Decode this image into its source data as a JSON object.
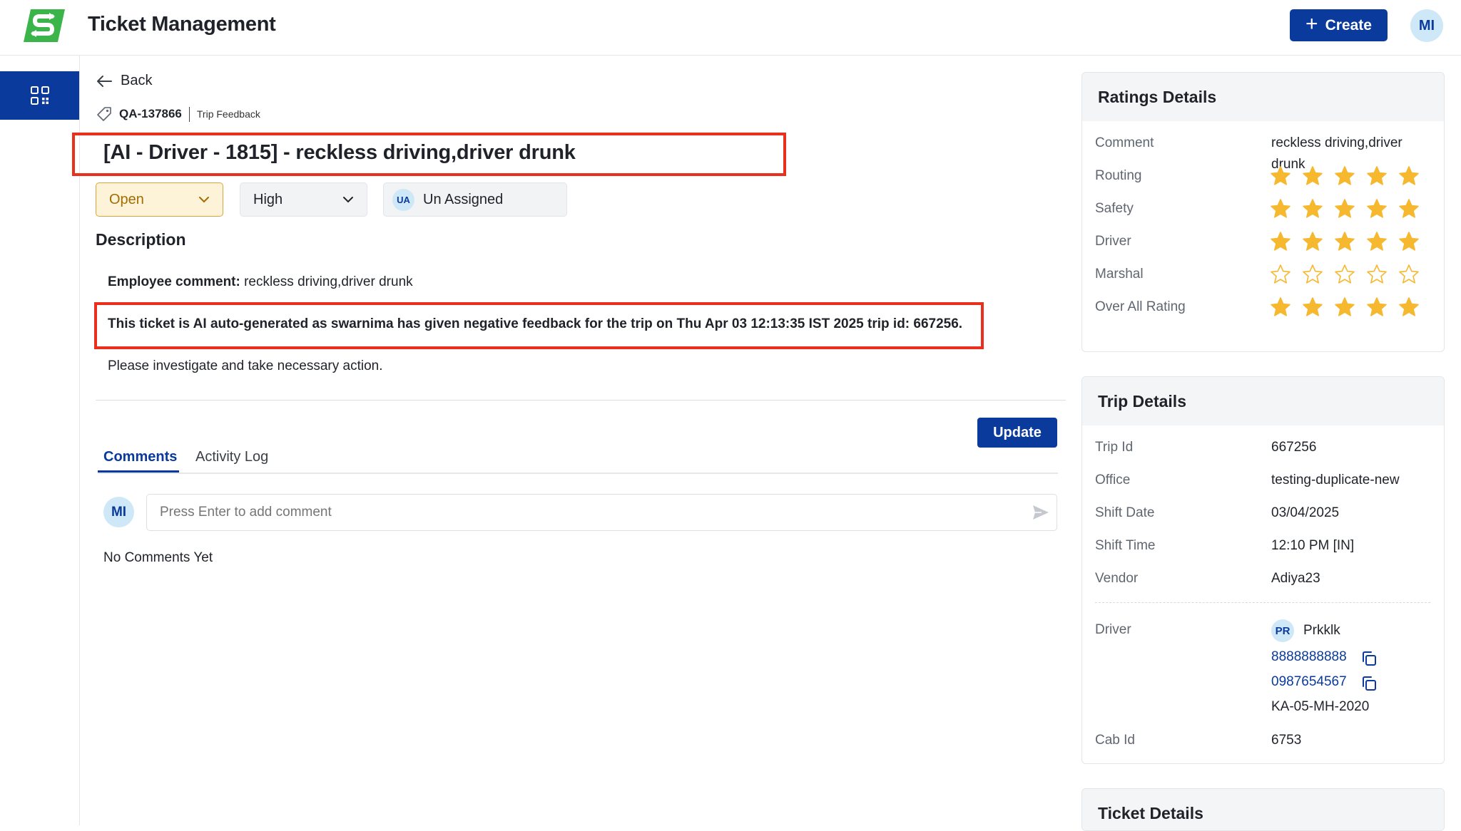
{
  "header": {
    "title": "Ticket Management",
    "create_label": "Create",
    "user_initials": "MI"
  },
  "colors": {
    "primary": "#0a3a9c",
    "highlight_border": "#e8301c",
    "status_open_bg": "#fdf3d8",
    "star_fill": "#f5b82e"
  },
  "ticket": {
    "back_label": "Back",
    "id": "QA-137866",
    "type": "Trip Feedback",
    "title": "[AI - Driver - 1815] - reckless driving,driver drunk",
    "status": "Open",
    "priority": "High",
    "assignee_initials": "UA",
    "assignee": "Un Assigned"
  },
  "description": {
    "heading": "Description",
    "employee_comment_label": "Employee comment:",
    "employee_comment": " reckless driving,driver drunk",
    "auto_text": "This ticket is AI auto-generated as swarnima has given negative feedback for the trip on Thu Apr 03 12:13:35 IST 2025 trip id: 667256.",
    "action_text": "Please investigate and take necessary action."
  },
  "actions": {
    "update_label": "Update"
  },
  "tabs": [
    {
      "label": "Comments",
      "active": true
    },
    {
      "label": "Activity Log",
      "active": false
    }
  ],
  "comments": {
    "user_initials": "MI",
    "placeholder": "Press Enter to add comment",
    "empty_text": "No Comments Yet"
  },
  "ratings": {
    "heading": "Ratings Details",
    "comment_label": "Comment",
    "comment_line1": "reckless driving,driver",
    "comment_line2": "drunk",
    "rows": [
      {
        "label": "Routing",
        "stars": 5
      },
      {
        "label": "Safety",
        "stars": 5
      },
      {
        "label": "Driver",
        "stars": 5
      },
      {
        "label": "Marshal",
        "stars": 0
      },
      {
        "label": "Over All Rating",
        "stars": 5
      }
    ],
    "max_stars": 5
  },
  "trip": {
    "heading": "Trip Details",
    "rows": [
      {
        "label": "Trip Id",
        "value": "667256"
      },
      {
        "label": "Office",
        "value": "testing-duplicate-new"
      },
      {
        "label": "Shift Date",
        "value": "03/04/2025"
      },
      {
        "label": "Shift Time",
        "value": "12:10 PM [IN]"
      },
      {
        "label": "Vendor",
        "value": "Adiya23"
      }
    ],
    "driver_label": "Driver",
    "driver_initials": "PR",
    "driver_name": "Prkklk",
    "phone1": "8888888888",
    "phone2": "0987654567",
    "vehicle_number": "KA-05-MH-2020",
    "cab_label": "Cab Id",
    "cab_id": "6753"
  },
  "ticket_details": {
    "heading": "Ticket Details"
  }
}
